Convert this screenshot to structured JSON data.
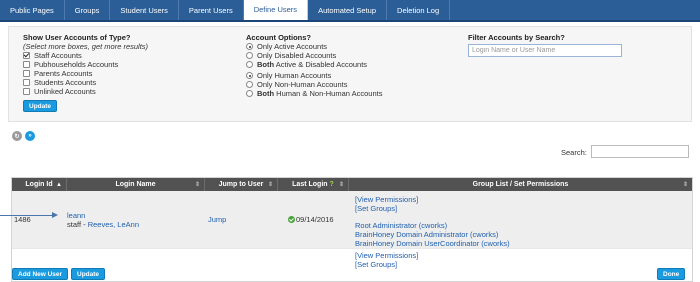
{
  "tabs": [
    {
      "label": "Public Pages",
      "active": false
    },
    {
      "label": "Groups",
      "active": false
    },
    {
      "label": "Student Users",
      "active": false
    },
    {
      "label": "Parent Users",
      "active": false
    },
    {
      "label": "Define Users",
      "active": true
    },
    {
      "label": "Automated Setup",
      "active": false
    },
    {
      "label": "Deletion Log",
      "active": false
    }
  ],
  "account_types": {
    "title": "Show User Accounts of Type?",
    "subtitle": "(Select more boxes, get more results)",
    "options": [
      {
        "label": "Staff Accounts",
        "checked": true
      },
      {
        "label": "Pubhouseholds Accounts",
        "checked": false
      },
      {
        "label": "Parents Accounts",
        "checked": false
      },
      {
        "label": "Students Accounts",
        "checked": false
      },
      {
        "label": "Unlinked Accounts",
        "checked": false
      }
    ],
    "update_label": "Update"
  },
  "account_options": {
    "title": "Account Options?",
    "group1": [
      {
        "bold": "",
        "label": "Only Active Accounts",
        "selected": true
      },
      {
        "bold": "",
        "label": "Only Disabled Accounts",
        "selected": false
      },
      {
        "bold": "Both",
        "label": " Active & Disabled Accounts",
        "selected": false
      }
    ],
    "group2": [
      {
        "bold": "",
        "label": "Only Human Accounts",
        "selected": true
      },
      {
        "bold": "",
        "label": "Only Non-Human Accounts",
        "selected": false
      },
      {
        "bold": "Both",
        "label": " Human & Non-Human Accounts",
        "selected": false
      }
    ]
  },
  "filter": {
    "title": "Filter Accounts by Search?",
    "placeholder": "Login Name or User Name",
    "value": ""
  },
  "icons": {
    "refresh": "refresh-icon",
    "export": "export-icon",
    "accent": "#1a9be0",
    "header_bg": "#525252",
    "tab_bg": "#2b5e97"
  },
  "search": {
    "label": "Search:",
    "value": ""
  },
  "table": {
    "headers": {
      "login_id": "Login Id",
      "login_name": "Login Name",
      "jump": "Jump to User",
      "last_login": "Last Login",
      "last_login_help": "?",
      "groups": "Group List / Set Permissions"
    },
    "rows": [
      {
        "login_id": "1486",
        "login_name": "leann",
        "user_prefix": "staff - ",
        "user_name": "Reeves, LeAnn",
        "jump": "Jump",
        "last_login": "09/14/2016",
        "view_permissions": "[View Permissions]",
        "set_groups": "[Set Groups]",
        "groups": [
          "Root Administrator (cworks)",
          "BrainHoney Domain Administrator (cworks)",
          "BrainHoney Domain UserCoordinator (cworks)"
        ]
      },
      {
        "login_id": "",
        "login_name": "",
        "user_prefix": "",
        "user_name": "",
        "jump": "",
        "last_login": "",
        "view_permissions": "[View Permissions]",
        "set_groups": "[Set Groups]",
        "groups": []
      }
    ]
  },
  "footer": {
    "add_new_user": "Add New User",
    "update": "Update",
    "done": "Done"
  }
}
